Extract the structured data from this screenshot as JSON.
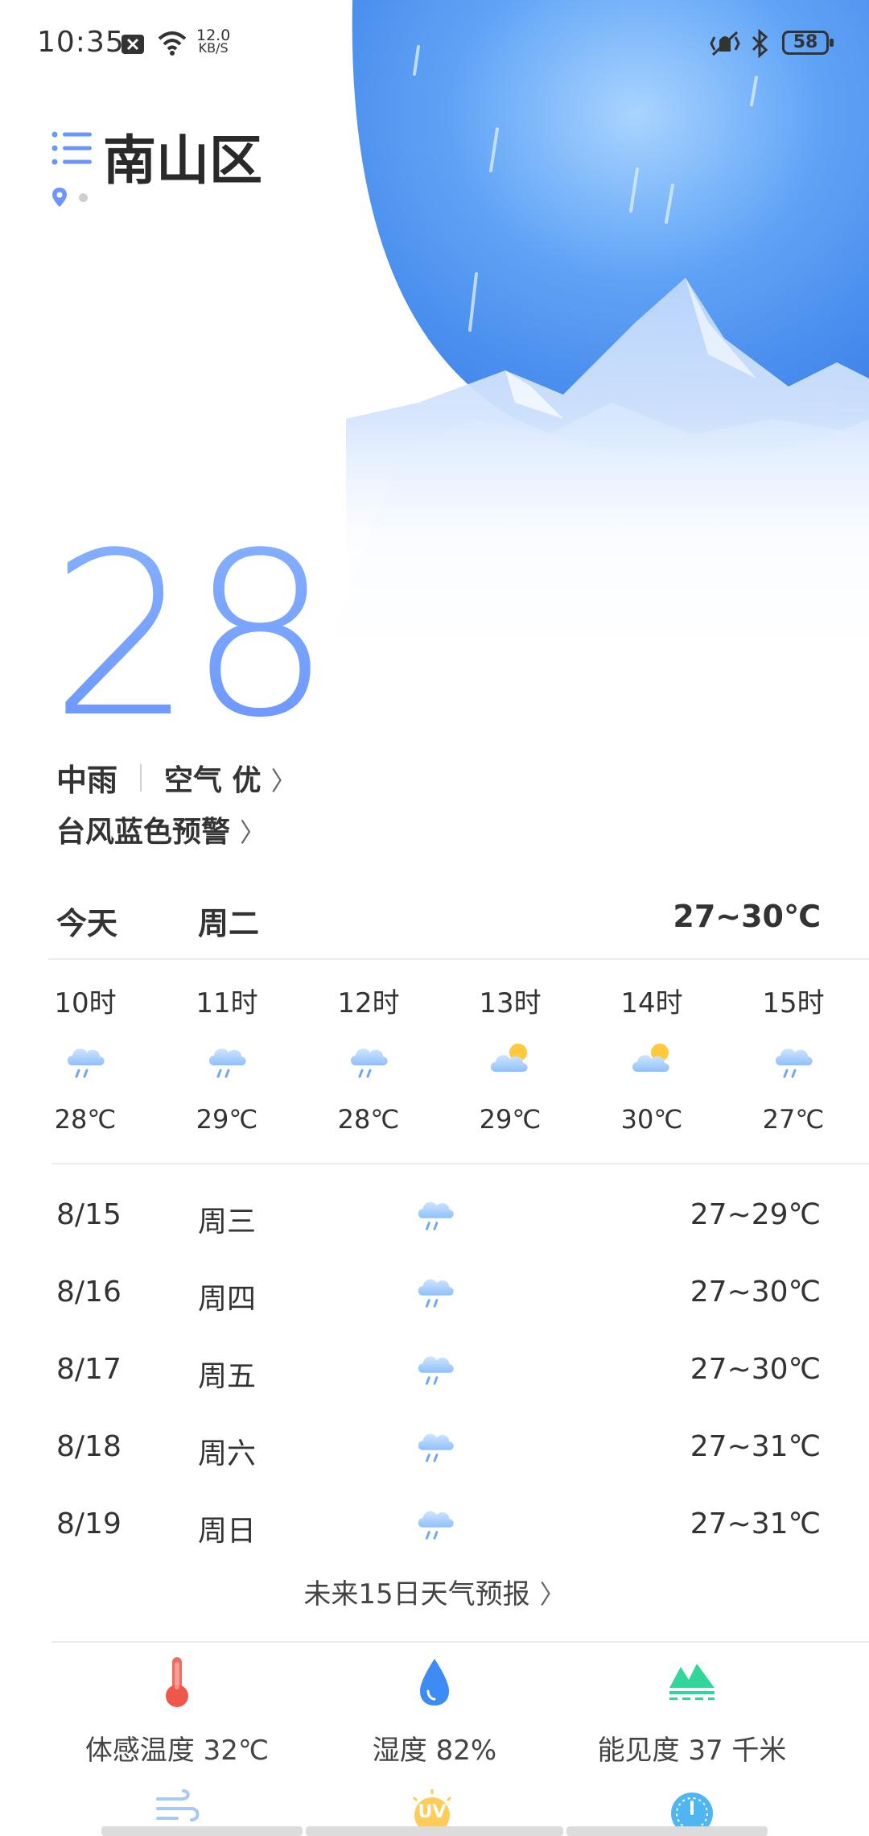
{
  "status_bar": {
    "time": "10:35",
    "net_speed_value": "12.0",
    "net_speed_unit": "KB/S",
    "battery": "58"
  },
  "header": {
    "city": "南山区"
  },
  "current": {
    "temperature": "28",
    "condition": "中雨",
    "air_quality": "空气 优",
    "warning": "台风蓝色预警"
  },
  "today": {
    "label": "今天",
    "weekday": "周二",
    "range": "27~30℃"
  },
  "hourly": [
    {
      "hour": "10时",
      "icon": "rain-cloud-icon",
      "temp": "28℃"
    },
    {
      "hour": "11时",
      "icon": "rain-cloud-icon",
      "temp": "29℃"
    },
    {
      "hour": "12时",
      "icon": "rain-cloud-icon",
      "temp": "28℃"
    },
    {
      "hour": "13时",
      "icon": "partly-sunny-icon",
      "temp": "29℃"
    },
    {
      "hour": "14时",
      "icon": "partly-sunny-icon",
      "temp": "30℃"
    },
    {
      "hour": "15时",
      "icon": "rain-cloud-icon",
      "temp": "27℃"
    }
  ],
  "daily": [
    {
      "date": "8/15",
      "weekday": "周三",
      "icon": "rain-cloud-icon",
      "range": "27~29℃"
    },
    {
      "date": "8/16",
      "weekday": "周四",
      "icon": "rain-cloud-icon",
      "range": "27~30℃"
    },
    {
      "date": "8/17",
      "weekday": "周五",
      "icon": "rain-cloud-icon",
      "range": "27~30℃"
    },
    {
      "date": "8/18",
      "weekday": "周六",
      "icon": "rain-cloud-icon",
      "range": "27~31℃"
    },
    {
      "date": "8/19",
      "weekday": "周日",
      "icon": "rain-cloud-icon",
      "range": "27~31℃"
    }
  ],
  "forecast_link": "未来15日天气预报",
  "details": [
    {
      "label": "体感温度 32℃",
      "icon": "thermometer-icon"
    },
    {
      "label": "湿度 82%",
      "icon": "water-drop-icon"
    },
    {
      "label": "能见度 37 千米",
      "icon": "visibility-icon"
    }
  ],
  "bottom_icons": {
    "uv_text": "UV"
  },
  "colors": {
    "accent": "#6b95ff",
    "sky_top": "#3f86ee",
    "thermometer": "#f0574b",
    "humidity": "#3d8cf5",
    "visibility": "#33d69a"
  }
}
